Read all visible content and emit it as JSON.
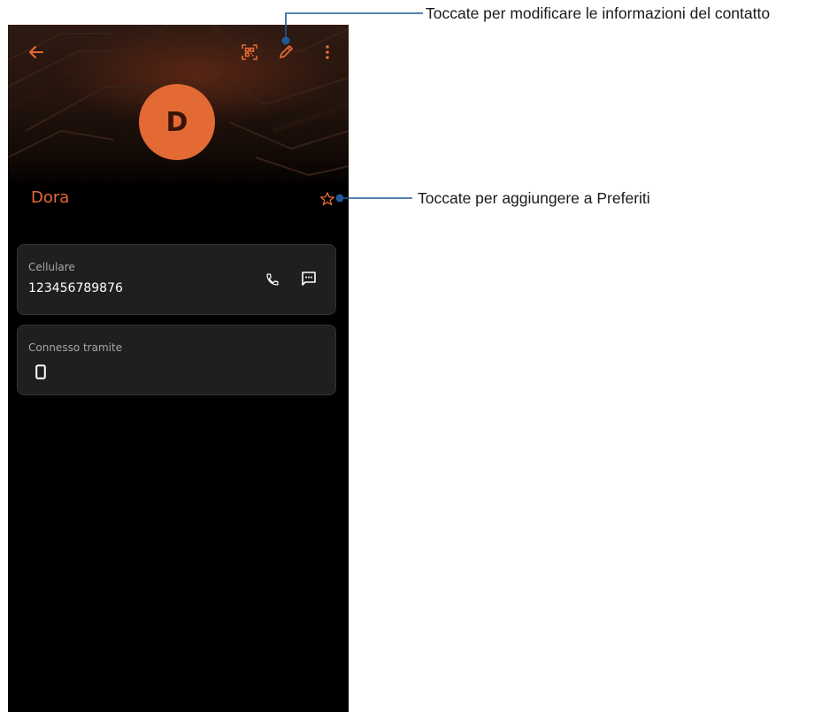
{
  "contact": {
    "initial": "D",
    "name": "Dora"
  },
  "toolbar": {
    "icons": [
      "back-arrow-icon",
      "qr-code-icon",
      "pencil-edit-icon",
      "more-vert-icon"
    ]
  },
  "cards": {
    "mobile": {
      "label": "Cellulare",
      "value": "123456789876",
      "icons": [
        "phone-call-icon",
        "message-icon"
      ]
    },
    "connected": {
      "label": "Connesso tramite",
      "icons": [
        "smartphone-icon"
      ]
    }
  },
  "callouts": {
    "edit": "Toccate per modificare le informazioni del contatto",
    "favorite": "Toccate per aggiungere a Preferiti"
  },
  "colors": {
    "accent": "#e36a35",
    "callout_line": "#1f5a96",
    "background": "#000000",
    "card": "#1f1f1f"
  }
}
